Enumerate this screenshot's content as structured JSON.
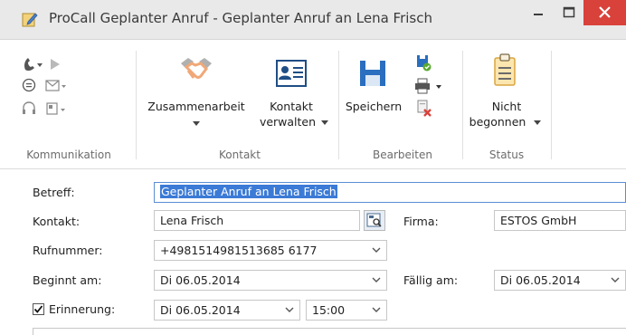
{
  "window": {
    "title": "ProCall Geplanter Anruf - Geplanter Anruf an Lena Frisch",
    "minimize_symbol": "–",
    "maximize_symbol": "☐",
    "close_symbol": "✕"
  },
  "ribbon": {
    "groups": {
      "kommunikation": "Kommunikation",
      "kontakt": "Kontakt",
      "bearbeiten": "Bearbeiten",
      "status": "Status"
    },
    "buttons": {
      "zusammenarbeit": "Zusammenarbeit",
      "kontakt_line1": "Kontakt",
      "kontakt_line2": "verwalten",
      "speichern": "Speichern",
      "status_line1": "Nicht",
      "status_line2": "begonnen"
    },
    "icons": [
      "phone-icon",
      "play-icon",
      "chat-icon",
      "mail-icon",
      "headset-icon",
      "voicemail-icon",
      "handshake-icon",
      "contact-card-icon",
      "save-icon",
      "save-close-icon",
      "print-icon",
      "delete-icon",
      "clipboard-icon"
    ]
  },
  "form": {
    "betreff_label": "Betreff:",
    "betreff_value": "Geplanter Anruf an Lena Frisch",
    "kontakt_label": "Kontakt:",
    "kontakt_value": "Lena Frisch",
    "firma_label": "Firma:",
    "firma_value": "ESTOS GmbH",
    "rufnummer_label": "Rufnummer:",
    "rufnummer_value": "+4981514981513685 6177",
    "beginnt_label": "Beginnt am:",
    "beginnt_value": "Di 06.05.2014",
    "faellig_label": "Fällig am:",
    "faellig_value": "Di 06.05.2014",
    "erinnerung_label": "Erinnerung:",
    "erinnerung_checked": true,
    "erinnerung_date": "Di 06.05.2014",
    "erinnerung_time": "15:00"
  },
  "colors": {
    "close_button": "#d9413b",
    "accent_blue": "#2a6ebf",
    "selection": "#3b7ad6"
  }
}
